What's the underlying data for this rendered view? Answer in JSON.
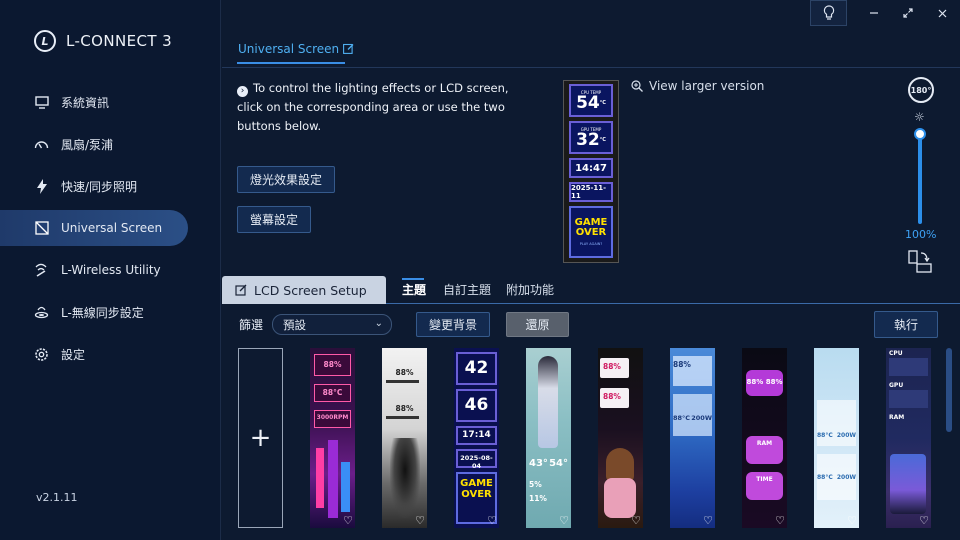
{
  "app": {
    "name": "L-CONNECT 3",
    "version": "v2.1.11"
  },
  "sidebar": {
    "items": [
      {
        "label": "系統資訊",
        "icon": "monitor-icon"
      },
      {
        "label": "風扇/泵浦",
        "icon": "fan-gauge-icon"
      },
      {
        "label": "快速/同步照明",
        "icon": "lightning-icon"
      },
      {
        "label": "Universal Screen",
        "icon": "screen-slash-icon",
        "active": true
      },
      {
        "label": "L-Wireless Utility",
        "icon": "wireless-icon"
      },
      {
        "label": "L-無線同步設定",
        "icon": "wireless-sync-icon"
      },
      {
        "label": "設定",
        "icon": "gear-icon"
      }
    ]
  },
  "header": {
    "tab": "Universal Screen",
    "accent": "#3a8ee6"
  },
  "info": {
    "text": "To control the lighting effects or LCD screen, click on the corresponding area or use the two buttons below.",
    "lighting_button": "燈光效果設定",
    "screen_button": "螢幕設定",
    "view_larger": "View larger version"
  },
  "lcd_preview": {
    "cpu_temp_label": "CPU TEMP",
    "cpu_temp": "54",
    "gpu_temp_label": "GPU TEMP",
    "gpu_temp": "32",
    "unit": "°C",
    "time": "14:47",
    "date": "2025-11-11",
    "game_over": "GAME OVER",
    "play_again": "PLAY AGAIN?"
  },
  "controls": {
    "rotate_label": "180°",
    "brightness": "100%"
  },
  "setup": {
    "title": "LCD Screen Setup",
    "tabs": [
      "主題",
      "自訂主題",
      "附加功能"
    ],
    "filter_label": "篩選",
    "filter_value": "預設",
    "change_bg": "變更背景",
    "restore": "還原",
    "execute": "執行"
  },
  "themes": [
    {
      "theme": "neon-city",
      "texts": [
        "88%",
        "88°C",
        "3000RPM"
      ]
    },
    {
      "theme": "samurai-ink",
      "texts": [
        "88%",
        "88%"
      ]
    },
    {
      "theme": "digital-blue",
      "texts": [
        "42",
        "46",
        "17:14",
        "2025-08-04",
        "GAME OVER"
      ]
    },
    {
      "theme": "anime-girl",
      "texts": [
        "43°",
        "54°",
        "5%",
        "11%"
      ]
    },
    {
      "theme": "cute-stars",
      "texts": [
        "88%",
        "88%"
      ]
    },
    {
      "theme": "blue-glass",
      "texts": [
        "88%",
        "88°C",
        "200W"
      ]
    },
    {
      "theme": "pink-bubbles",
      "texts": [
        "88% 88%",
        "RAM",
        "TIME"
      ]
    },
    {
      "theme": "ice-pastel",
      "texts": [
        "88°C",
        "200W",
        "88°C",
        "200W"
      ]
    },
    {
      "theme": "gamer-room",
      "texts": [
        "CPU",
        "GPU",
        "RAM"
      ]
    }
  ]
}
